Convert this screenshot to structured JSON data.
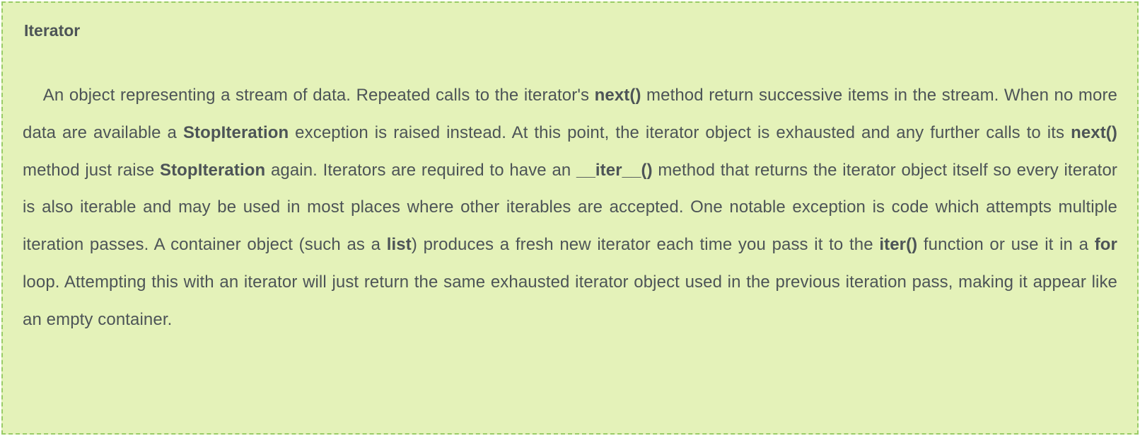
{
  "callout": {
    "title": "Iterator",
    "body_segments": [
      {
        "t": "An object representing a stream of data. Repeated calls to the iterator's "
      },
      {
        "t": "next()",
        "b": true
      },
      {
        "t": " method return successive items in the stream. When no more data are available a "
      },
      {
        "t": "StopIteration",
        "b": true
      },
      {
        "t": " exception is raised instead. At this point, the iterator object is exhausted and any further calls to its "
      },
      {
        "t": "next()",
        "b": true
      },
      {
        "t": " method just raise "
      },
      {
        "t": "StopIteration",
        "b": true
      },
      {
        "t": " again. Iterators are required to have an "
      },
      {
        "t": "__iter__()",
        "b": true
      },
      {
        "t": " method that returns the iterator object itself so every iterator is also iterable and may be used in most places where other iterables are accepted. One notable exception is code which attempts multiple iteration passes. A container object (such as a "
      },
      {
        "t": "list",
        "b": true
      },
      {
        "t": ") produces a fresh new iterator each time you pass it to the "
      },
      {
        "t": "iter()",
        "b": true
      },
      {
        "t": " function or use it in a "
      },
      {
        "t": "for",
        "b": true
      },
      {
        "t": " loop. Attempting this with an iterator will just return the same exhausted iterator object used in the previous iteration pass, making it appear like an empty container."
      }
    ]
  }
}
